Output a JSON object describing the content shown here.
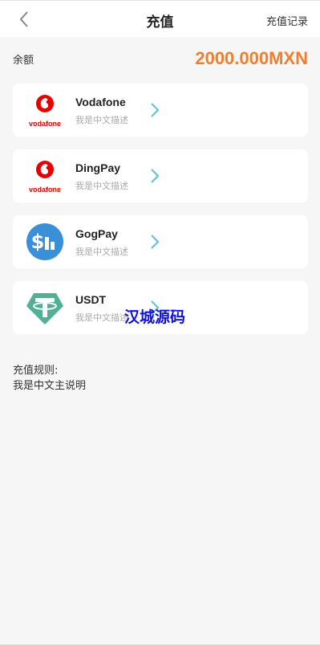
{
  "header": {
    "title": "充值",
    "records_label": "充值记录"
  },
  "balance": {
    "label": "余额",
    "value": "2000.000MXN"
  },
  "methods": [
    {
      "name": "Vodafone",
      "desc": "我是中文描述",
      "logo_text": "vodafone",
      "icon": "vodafone-logo"
    },
    {
      "name": "DingPay",
      "desc": "我是中文描述",
      "logo_text": "vodafone",
      "icon": "vodafone-logo"
    },
    {
      "name": "GogPay",
      "desc": "我是中文描述",
      "icon": "dollar-chart-logo"
    },
    {
      "name": "USDT",
      "desc": "我是中文描述",
      "icon": "tether-logo"
    }
  ],
  "watermark": "汉城源码",
  "rules": {
    "title": "充值规则:",
    "body": "我是中文主说明"
  },
  "colors": {
    "accent": "#f07f2d",
    "chevron": "#5bc0de",
    "vodafone_red": "#e60000",
    "gogpay_blue": "#3a8fd9",
    "tether_green": "#50af95",
    "watermark": "#1010e0"
  }
}
